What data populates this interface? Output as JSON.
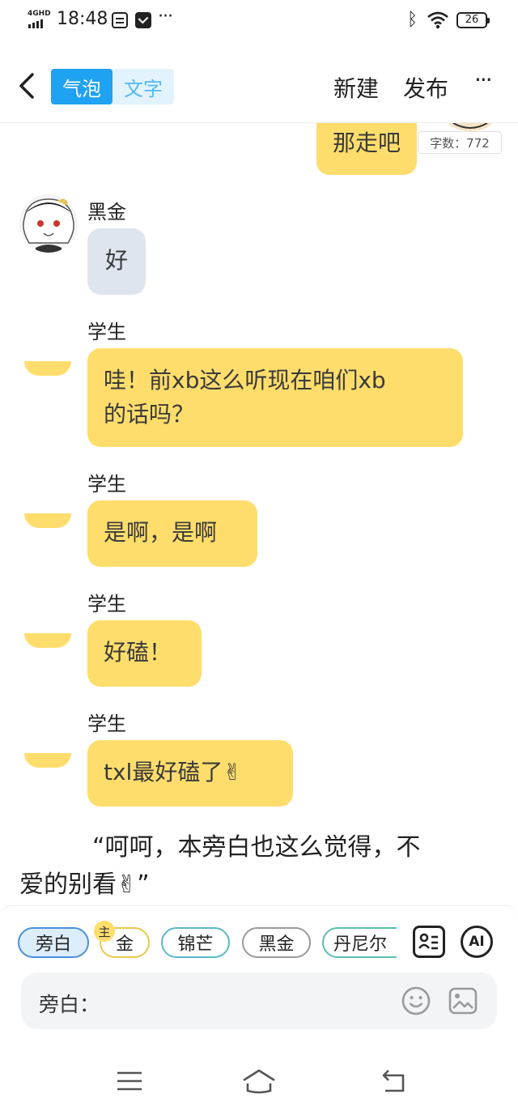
{
  "status_bar": {
    "network": "4GHD",
    "time": "18:48",
    "battery": "26"
  },
  "header": {
    "tab_bubble": "气泡",
    "tab_text": "文字",
    "new_label": "新建",
    "publish_label": "发布",
    "more_label": "···"
  },
  "chat": {
    "word_count": "字数：772",
    "messages": [
      {
        "speaker": "",
        "text": "那走吧",
        "style": "yellow"
      },
      {
        "speaker": "黑金",
        "text": "好",
        "style": "gray"
      },
      {
        "speaker": "学生",
        "text_line1": "哇！前xb这么听现在咱们xb",
        "text_line2": "的话吗？",
        "style": "yellow"
      },
      {
        "speaker": "学生",
        "text": "是啊，是啊",
        "style": "yellow"
      },
      {
        "speaker": "学生",
        "text": "好磕！",
        "style": "yellow"
      },
      {
        "speaker": "学生",
        "text": "txl最好磕了✌",
        "style": "yellow"
      }
    ],
    "narration_line1": "“呵呵，本旁白也这么觉得，不",
    "narration_line2": "爱的别看✌”"
  },
  "panel": {
    "chips": [
      "旁白",
      "金",
      "锦芒",
      "黑金",
      "丹尼尔"
    ],
    "lead_badge": "主",
    "ai_label": "AI",
    "input_label": "旁白：",
    "input_value": ""
  },
  "colors": {
    "accent_blue": "#1ea2f1",
    "bubble_yellow": "#ffdd6c",
    "bubble_gray": "#dfe5ee"
  },
  "icons": [
    "back-icon",
    "card-icon",
    "ai-icon",
    "emoji-icon",
    "image-icon",
    "menu-icon",
    "home-icon",
    "return-icon"
  ]
}
